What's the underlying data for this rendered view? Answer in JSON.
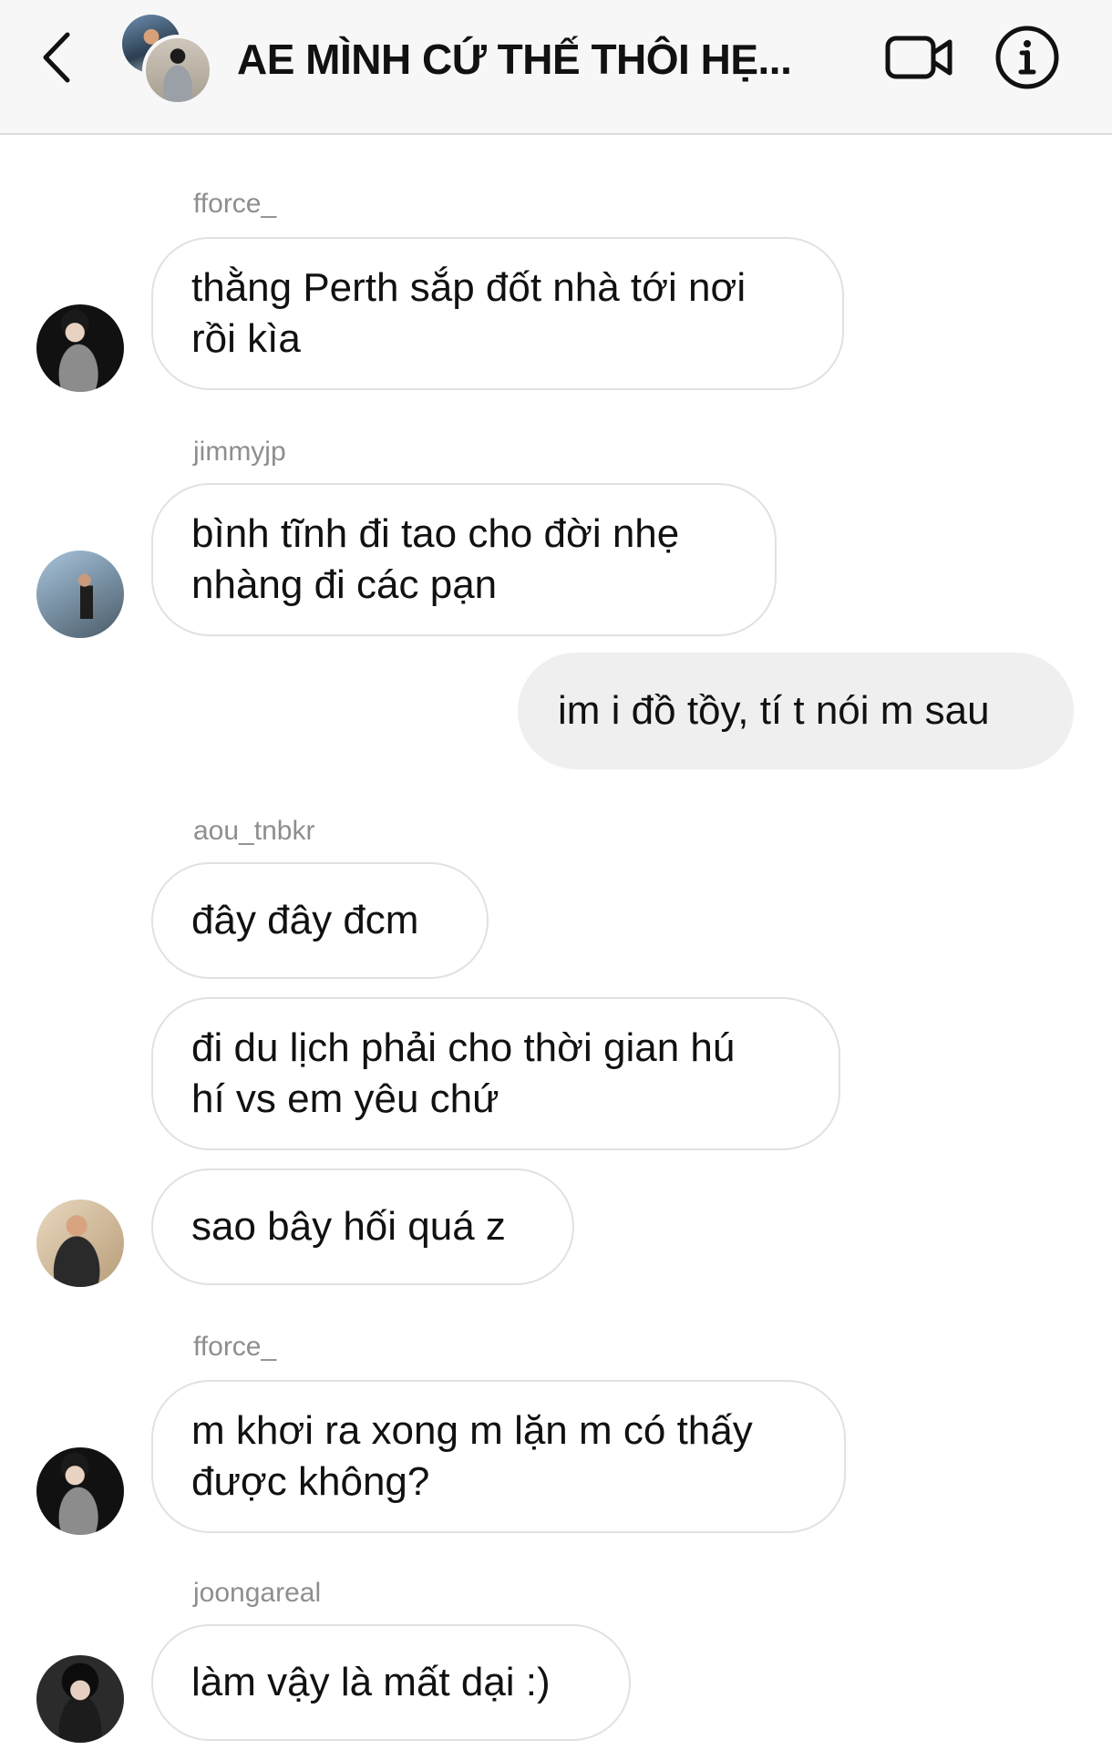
{
  "header": {
    "title": "AE MÌNH CỨ THẾ THÔI HẸ...",
    "back_icon": "chevron-left-icon",
    "video_icon": "video-camera-icon",
    "info_icon": "info-icon"
  },
  "messages": [
    {
      "sender": "fforce_",
      "text": "thằng Perth sắp đốt nhà tới nơi\nrồi kìa",
      "mine": false
    },
    {
      "sender": "jimmyjp",
      "text": "bình tĩnh đi tao cho đời nhẹ\nnhàng đi các pạn",
      "mine": false
    },
    {
      "sender": "",
      "text": "im i đồ tồy, tí t nói m sau",
      "mine": true
    },
    {
      "sender": "aou_tnbkr",
      "text": "đây đây đcm",
      "mine": false
    },
    {
      "sender": "",
      "text": "đi du lịch phải cho thời gian hú\nhí vs em yêu chứ",
      "mine": false
    },
    {
      "sender": "",
      "text": "sao bây hối quá z",
      "mine": false
    },
    {
      "sender": "fforce_",
      "text": "m khơi ra xong m lặn m có thấy\nđược không?",
      "mine": false
    },
    {
      "sender": "joongareal",
      "text": "làm vậy là mất dại :)",
      "mine": false
    }
  ],
  "colors": {
    "header_bg": "#f7f7f7",
    "bubble_border": "#e1e1e1",
    "mine_bubble_bg": "#efefef",
    "sender_text": "#8e8e8e"
  }
}
